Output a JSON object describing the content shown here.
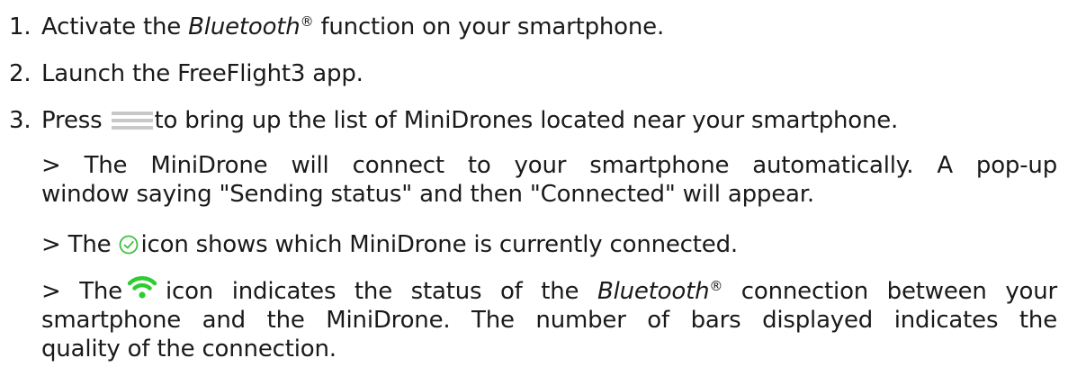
{
  "steps": [
    {
      "number": "1.",
      "pre": "Activate the ",
      "italic": "Bluetooth",
      "reg": "®",
      "post": " function on your smartphone."
    },
    {
      "number": "2.",
      "text": "Launch the FreeFlight3 app."
    },
    {
      "number": "3.",
      "pre": "Press",
      "post": "to bring up the list of MiniDrones located near your smartphone.",
      "icon": "menu-icon"
    }
  ],
  "notes": {
    "connect": {
      "line1": "> The MiniDrone will connect to your smartphone automatically. A pop-up",
      "line2": "window saying \"Sending status\" and then \"Connected\" will appear."
    },
    "check": {
      "pre": "> The",
      "post": "icon shows which MiniDrone is currently connected.",
      "icon": "check-circle-icon",
      "icon_color": "#3fbf3f"
    },
    "signal": {
      "pre": "> The",
      "mid": "icon indicates the status of the ",
      "italic": "Bluetooth",
      "reg": "®",
      "post": " connection between your",
      "line2": "smartphone and the MiniDrone. The number of bars displayed indicates the",
      "line3": "quality of the connection.",
      "icon": "wifi-signal-icon",
      "icon_color": "#2ecc2e"
    }
  }
}
